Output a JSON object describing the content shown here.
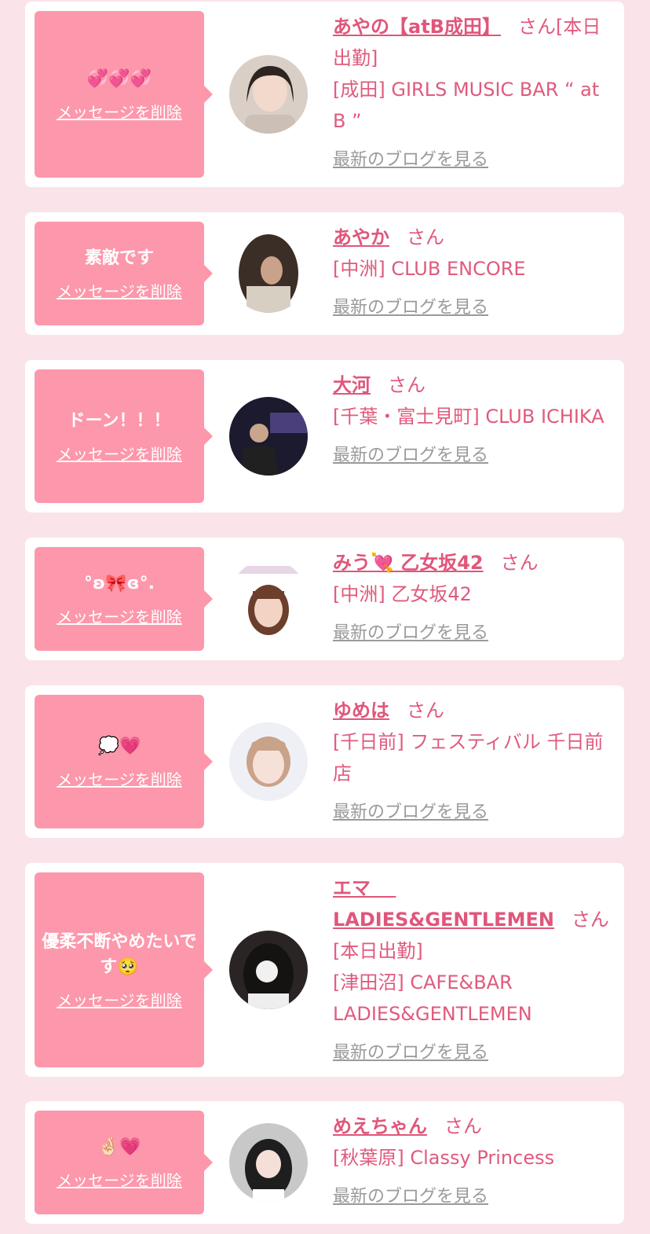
{
  "delete_label": "メッセージを削除",
  "blog_label": "最新のブログを見る",
  "san_label": "さん",
  "cards": [
    {
      "message": "💞💞💞",
      "name": "あやの【atB成田】",
      "extra": "[本日出勤]",
      "shop": "[成田] GIRLS MUSIC BAR “ at B ”"
    },
    {
      "message": "素敵です",
      "name": "あやか",
      "shop": "[中洲] CLUB ENCORE"
    },
    {
      "message": "ドーン！！！",
      "name": "大河",
      "shop": "[千葉・富士見町] CLUB ICHIKA"
    },
    {
      "message": "°ʚ🎀ɞ°.",
      "name": "みう💘 乙女坂42",
      "shop": "[中洲] 乙女坂42"
    },
    {
      "message": "💭💗",
      "name": "ゆめは",
      "shop": "[千日前] フェスティバル 千日前店"
    },
    {
      "message": "優柔不断やめたいです🥺",
      "name": "エマ　 LADIES&GENTLEMEN",
      "extra": "[本日出勤]",
      "shop": "[津田沼] CAFE&BAR LADIES&GENTLEMEN"
    },
    {
      "message": "🤞🏻💗",
      "name": "めえちゃん",
      "shop": "[秋葉原] Classy Princess"
    }
  ],
  "colors": {
    "page_bg": "#fbe3ea",
    "bubble": "#fd97ab",
    "name": "#e0567a",
    "shop_text": "#e05a7c",
    "link_gray": "#9a9a9a"
  },
  "icons": {
    "avatar": "profile-photo",
    "bubble_arrow": "speech-pointer"
  }
}
